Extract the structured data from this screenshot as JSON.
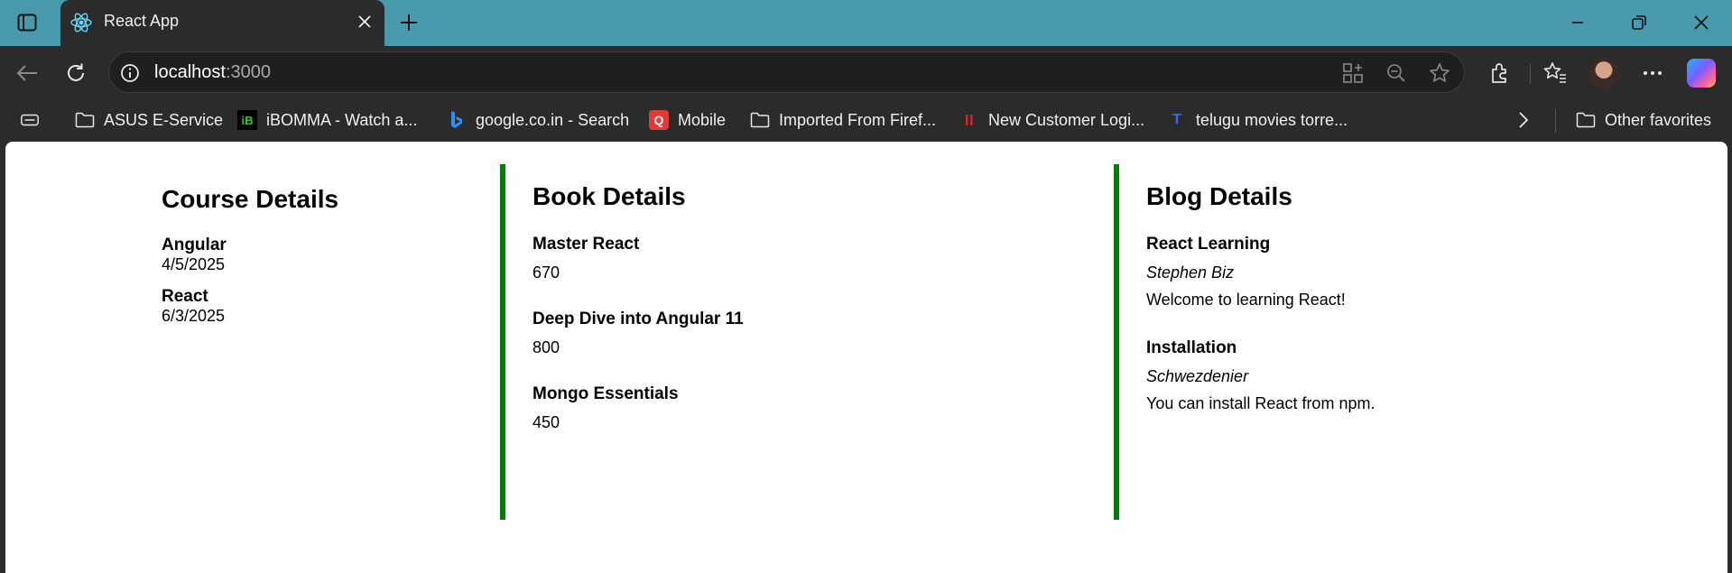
{
  "browser": {
    "tab_title": "React App",
    "url_host": "localhost",
    "url_port": ":3000",
    "titlebar_color": "#4a9aad",
    "bookmarks": [
      {
        "label": "ASUS E-Service",
        "icon": "folder-icon"
      },
      {
        "label": "iBOMMA - Watch a...",
        "icon": "ibomma-icon"
      },
      {
        "label": "google.co.in - Search",
        "icon": "bing-icon"
      },
      {
        "label": "Mobile",
        "icon": "mobile-app-icon"
      },
      {
        "label": "Imported From Firef...",
        "icon": "folder-icon"
      },
      {
        "label": "New Customer Logi...",
        "icon": "red-bars-icon"
      },
      {
        "label": "telugu movies torre...",
        "icon": "t-icon"
      }
    ],
    "other_favorites": "Other favorites"
  },
  "page": {
    "accent_color": "#008000",
    "course": {
      "title": "Course Details",
      "items": [
        {
          "name": "Angular",
          "date": "4/5/2025"
        },
        {
          "name": "React",
          "date": "6/3/2025"
        }
      ]
    },
    "book": {
      "title": "Book Details",
      "items": [
        {
          "name": "Master React",
          "price": "670"
        },
        {
          "name": "Deep Dive into Angular 11",
          "price": "800"
        },
        {
          "name": "Mongo Essentials",
          "price": "450"
        }
      ]
    },
    "blog": {
      "title": "Blog Details",
      "items": [
        {
          "title": "React Learning",
          "author": "Stephen Biz",
          "content": "Welcome to learning React!"
        },
        {
          "title": "Installation",
          "author": "Schwezdenier",
          "content": "You can install React from npm."
        }
      ]
    }
  }
}
